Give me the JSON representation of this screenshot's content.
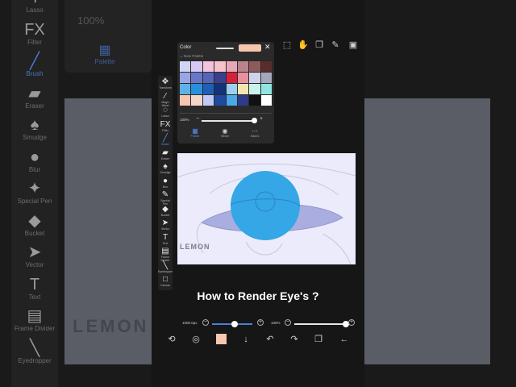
{
  "background": {
    "toolbar": [
      {
        "icon": "lasso-icon",
        "label": "Lasso"
      },
      {
        "icon": "fx-icon",
        "glyph": "FX",
        "label": "Filter"
      },
      {
        "icon": "brush-icon",
        "label": "Brush",
        "selected": true
      },
      {
        "icon": "eraser-icon",
        "label": "Eraser"
      },
      {
        "icon": "smudge-icon",
        "label": "Smudge"
      },
      {
        "icon": "blur-icon",
        "label": "Blur"
      },
      {
        "icon": "special-pen-icon",
        "label": "Special Pen"
      },
      {
        "icon": "bucket-icon",
        "label": "Bucket"
      },
      {
        "icon": "vector-icon",
        "label": "Vector"
      },
      {
        "icon": "text-icon",
        "glyph": "T",
        "label": "Text"
      },
      {
        "icon": "frame-divider-icon",
        "label": "Frame Divider"
      },
      {
        "icon": "eyedropper-icon",
        "label": "Eyedropper"
      }
    ],
    "zoom": "100%",
    "palette_label": "Palette",
    "watermark": "LEMON"
  },
  "color_panel": {
    "title": "Color",
    "accent_color": "#f7c6ae",
    "palette_name": "New Palette",
    "colors": [
      "#cfd6f5",
      "#d8c9f2",
      "#f3c4dd",
      "#f6c2cc",
      "#e9a8b8",
      "#b8838a",
      "#8f5a5a",
      "#5a2c2c",
      "#9aa5e6",
      "#6a77c9",
      "#5566b8",
      "#3a3f8f",
      "#d6213a",
      "#e98fa0",
      "#cfd4ea",
      "#a3a8bd",
      "#5fb1e8",
      "#2a8fdc",
      "#1f5fb5",
      "#12337a",
      "#9ad0f0",
      "#f4e5b0",
      "#c8f2ea",
      "#8fe6e0",
      "#f7c6ae",
      "#f2d6c8",
      "#c2c8f4",
      "#1f4aa0",
      "#4aa8e8",
      "#2f3a8a",
      "#111111",
      "#ffffff"
    ],
    "opacity": "100%",
    "tabs": [
      {
        "icon": "palette-grid-icon",
        "label": "Palette",
        "selected": true
      },
      {
        "icon": "wheel-icon",
        "label": "Wheel"
      },
      {
        "icon": "sliders-icon",
        "label": "Sliders"
      }
    ]
  },
  "toolbar": [
    {
      "icon": "transform-icon",
      "glyph": "✥",
      "label": "Transform"
    },
    {
      "icon": "magic-wand-icon",
      "glyph": "⁄",
      "label": "Magic Wand"
    },
    {
      "icon": "lasso-icon",
      "glyph": "◌",
      "label": "Lasso"
    },
    {
      "icon": "fx-icon",
      "glyph": "FX",
      "label": "Filter"
    },
    {
      "icon": "brush-icon",
      "glyph": "╱",
      "label": "Brush",
      "selected": true
    },
    {
      "icon": "eraser-icon",
      "glyph": "▰",
      "label": "Eraser"
    },
    {
      "icon": "smudge-icon",
      "glyph": "♠",
      "label": "Smudge"
    },
    {
      "icon": "blur-icon",
      "glyph": "●",
      "label": "Blur"
    },
    {
      "icon": "special-pen-icon",
      "glyph": "✎",
      "label": "Special Pen"
    },
    {
      "icon": "bucket-icon",
      "glyph": "◆",
      "label": "Bucket"
    },
    {
      "icon": "vector-icon",
      "glyph": "➤",
      "label": "Vector"
    },
    {
      "icon": "text-icon",
      "glyph": "T",
      "label": "Text"
    },
    {
      "icon": "frame-divider-icon",
      "glyph": "▤",
      "label": "Frame Divider"
    },
    {
      "icon": "eyedropper-icon",
      "glyph": "╲",
      "label": "Eyedropper"
    },
    {
      "icon": "canvas-icon",
      "glyph": "□",
      "label": "Canvas"
    }
  ],
  "artwork": {
    "watermark": "LEMON",
    "iris_color": "#35a6e6",
    "sclera_color": "#a9addf"
  },
  "caption": "How to Render Eye's ?",
  "sliders": {
    "brush_size": "1000.0px",
    "brush_size_level": 0.55,
    "brush_opacity": "100%",
    "brush_opacity_level": 1.0
  },
  "bottom_bar": {
    "current_color": "#f7c6ae"
  }
}
